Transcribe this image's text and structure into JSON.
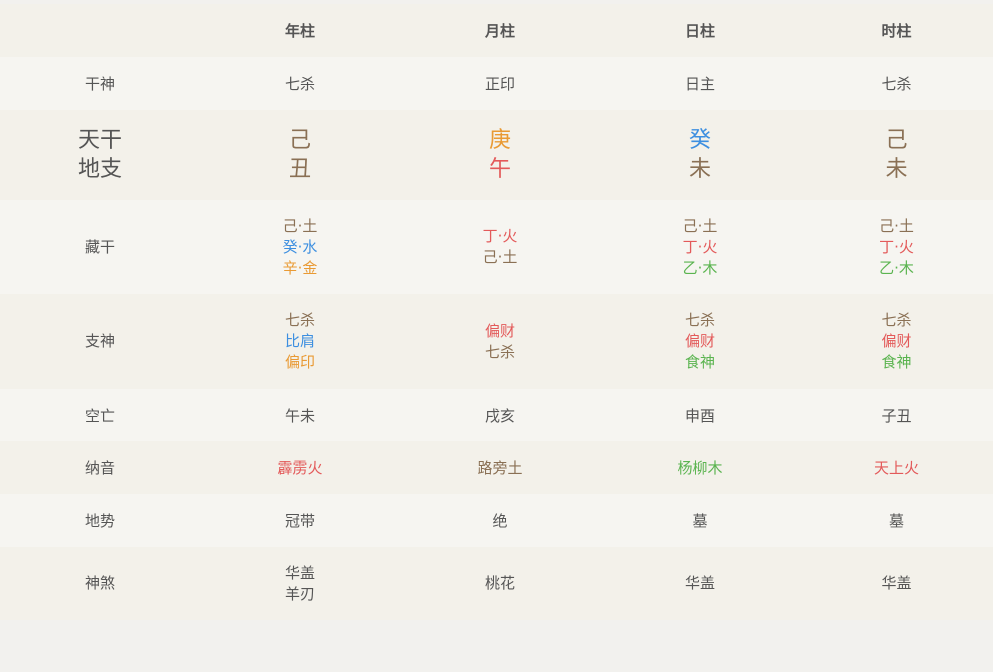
{
  "header": {
    "blank": "",
    "columns": [
      "年柱",
      "月柱",
      "日柱",
      "时柱"
    ]
  },
  "rows": {
    "gan_shen": {
      "label": "干神",
      "values": [
        "七杀",
        "正印",
        "日主",
        "七杀"
      ]
    },
    "gan_zhi": {
      "label_top": "天干",
      "label_bottom": "地支",
      "stems": [
        {
          "text": "己",
          "element": "earth"
        },
        {
          "text": "庚",
          "element": "metal"
        },
        {
          "text": "癸",
          "element": "water"
        },
        {
          "text": "己",
          "element": "earth"
        }
      ],
      "branches": [
        {
          "text": "丑",
          "element": "earth"
        },
        {
          "text": "午",
          "element": "fire"
        },
        {
          "text": "未",
          "element": "earth"
        },
        {
          "text": "未",
          "element": "earth"
        }
      ]
    },
    "cang_gan": {
      "label": "藏干",
      "values": [
        [
          {
            "text": "己·土",
            "element": "earth"
          },
          {
            "text": "癸·水",
            "element": "water"
          },
          {
            "text": "辛·金",
            "element": "metal"
          }
        ],
        [
          {
            "text": "丁·火",
            "element": "fire"
          },
          {
            "text": "己·土",
            "element": "earth"
          }
        ],
        [
          {
            "text": "己·土",
            "element": "earth"
          },
          {
            "text": "丁·火",
            "element": "fire"
          },
          {
            "text": "乙·木",
            "element": "wood"
          }
        ],
        [
          {
            "text": "己·土",
            "element": "earth"
          },
          {
            "text": "丁·火",
            "element": "fire"
          },
          {
            "text": "乙·木",
            "element": "wood"
          }
        ]
      ]
    },
    "zhi_shen": {
      "label": "支神",
      "values": [
        [
          {
            "text": "七杀",
            "element": "earth"
          },
          {
            "text": "比肩",
            "element": "water"
          },
          {
            "text": "偏印",
            "element": "metal"
          }
        ],
        [
          {
            "text": "偏财",
            "element": "fire"
          },
          {
            "text": "七杀",
            "element": "earth"
          }
        ],
        [
          {
            "text": "七杀",
            "element": "earth"
          },
          {
            "text": "偏财",
            "element": "fire"
          },
          {
            "text": "食神",
            "element": "wood"
          }
        ],
        [
          {
            "text": "七杀",
            "element": "earth"
          },
          {
            "text": "偏财",
            "element": "fire"
          },
          {
            "text": "食神",
            "element": "wood"
          }
        ]
      ]
    },
    "kong_wang": {
      "label": "空亡",
      "values": [
        "午未",
        "戌亥",
        "申酉",
        "子丑"
      ]
    },
    "na_yin": {
      "label": "纳音",
      "values": [
        {
          "text": "霹雳火",
          "element": "fire"
        },
        {
          "text": "路旁土",
          "element": "earth"
        },
        {
          "text": "杨柳木",
          "element": "wood"
        },
        {
          "text": "天上火",
          "element": "fire"
        }
      ]
    },
    "di_shi": {
      "label": "地势",
      "values": [
        "冠带",
        "绝",
        "墓",
        "墓"
      ]
    },
    "shen_sha": {
      "label": "神煞",
      "values": [
        [
          "华盖",
          "羊刃"
        ],
        [
          "桃花"
        ],
        [
          "华盖"
        ],
        [
          "华盖"
        ]
      ]
    }
  },
  "colors": {
    "earth": "#8a7054",
    "water": "#3d8fe0",
    "metal": "#e99a34",
    "fire": "#e35a5a",
    "wood": "#5bb450",
    "text": "#555555",
    "bg": "#f2f1ee"
  }
}
